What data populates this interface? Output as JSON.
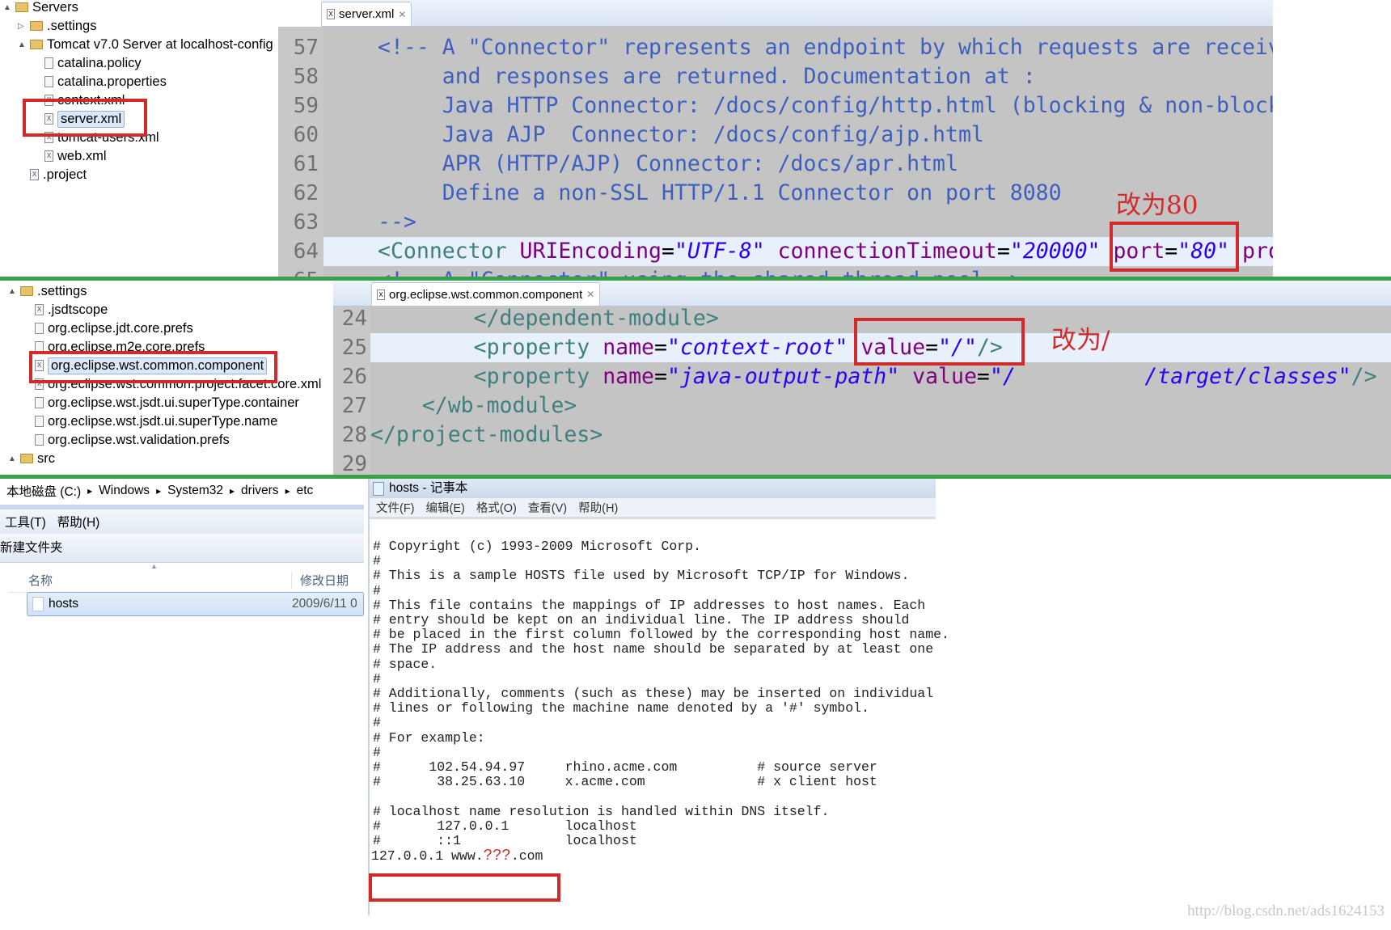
{
  "panel1": {
    "tree": [
      {
        "label": "Servers",
        "icon": "folder-open-icon",
        "depth": 0,
        "arrow": "▲"
      },
      {
        "label": ".settings",
        "icon": "folder-icon",
        "depth": 1,
        "arrow": "▷"
      },
      {
        "label": "Tomcat v7.0 Server at localhost-config",
        "icon": "folder-open-icon",
        "depth": 1,
        "arrow": "▲"
      },
      {
        "label": "catalina.policy",
        "icon": "file-icon",
        "depth": 2
      },
      {
        "label": "catalina.properties",
        "icon": "file-icon",
        "depth": 2
      },
      {
        "label": "context.xml",
        "icon": "xml-file-icon",
        "depth": 2
      },
      {
        "label": "server.xml",
        "icon": "xml-file-icon",
        "depth": 2,
        "selected": true
      },
      {
        "label": "tomcat-users.xml",
        "icon": "xml-file-icon",
        "depth": 2
      },
      {
        "label": "web.xml",
        "icon": "xml-file-icon",
        "depth": 2
      },
      {
        "label": ".project",
        "icon": "xml-file-icon",
        "depth": 1
      }
    ],
    "tab": "server.xml",
    "lines": [
      {
        "n": "57",
        "tokens": [
          [
            "<!-- A \"Connector\" represents an endpoint by which requests are received",
            "comment"
          ]
        ]
      },
      {
        "n": "58",
        "tokens": [
          [
            "     and responses are returned. Documentation at :",
            "comment"
          ]
        ]
      },
      {
        "n": "59",
        "tokens": [
          [
            "     Java HTTP Connector: /docs/config/http.html (blocking & non-blocking)",
            "comment"
          ]
        ]
      },
      {
        "n": "60",
        "tokens": [
          [
            "     Java AJP  Connector: /docs/config/ajp.html",
            "comment"
          ]
        ]
      },
      {
        "n": "61",
        "tokens": [
          [
            "     APR (HTTP/AJP) Connector: /docs/apr.html",
            "comment"
          ]
        ]
      },
      {
        "n": "62",
        "tokens": [
          [
            "     Define a non-SSL HTTP/1.1 Connector on port 8080",
            "comment"
          ]
        ]
      },
      {
        "n": "63",
        "tokens": [
          [
            "-->",
            "comment"
          ]
        ]
      },
      {
        "n": "64",
        "highlight": true,
        "tokens": [
          [
            "<Connector",
            "tag"
          ],
          [
            " URIEncoding",
            "attr"
          ],
          [
            "=",
            "punct"
          ],
          [
            "\"UTF-8\"",
            "val"
          ],
          [
            " connectionTimeout",
            "attr"
          ],
          [
            "=",
            "punct"
          ],
          [
            "\"20000\"",
            "val"
          ],
          [
            " port",
            "attr"
          ],
          [
            "=",
            "punct"
          ],
          [
            "\"80\"",
            "val"
          ],
          [
            " protocol",
            "attr"
          ]
        ]
      },
      {
        "n": "65",
        "tokens": [
          [
            "<!-- A \"Connector\" using the shared thread pool-->",
            "comment"
          ]
        ]
      }
    ],
    "annotation": "改为80"
  },
  "panel2": {
    "tree": [
      {
        "label": ".settings",
        "icon": "folder-open-icon",
        "depth": 0,
        "arrow": "▲"
      },
      {
        "label": ".jsdtscope",
        "icon": "xml-file-icon",
        "depth": 1
      },
      {
        "label": "org.eclipse.jdt.core.prefs",
        "icon": "file-icon",
        "depth": 1
      },
      {
        "label": "org.eclipse.m2e.core.prefs",
        "icon": "file-icon",
        "depth": 1
      },
      {
        "label": "org.eclipse.wst.common.component",
        "icon": "xml-file-icon",
        "depth": 1,
        "selected": true
      },
      {
        "label": "org.eclipse.wst.common.project.facet.core.xml",
        "icon": "xml-file-icon",
        "depth": 1
      },
      {
        "label": "org.eclipse.wst.jsdt.ui.superType.container",
        "icon": "file-icon",
        "depth": 1
      },
      {
        "label": "org.eclipse.wst.jsdt.ui.superType.name",
        "icon": "file-icon",
        "depth": 1
      },
      {
        "label": "org.eclipse.wst.validation.prefs",
        "icon": "file-icon",
        "depth": 1
      },
      {
        "label": "src",
        "icon": "source-folder-icon",
        "depth": 0,
        "arrow": "▲"
      }
    ],
    "tab": "org.eclipse.wst.common.component",
    "lines": [
      {
        "n": "24",
        "tokens": [
          [
            "        </dependent-module>",
            "tag"
          ]
        ]
      },
      {
        "n": "25",
        "highlight": true,
        "tokens": [
          [
            "        <property",
            "tag"
          ],
          [
            " name",
            "attr"
          ],
          [
            "=",
            "punct"
          ],
          [
            "\"context-root\"",
            "val"
          ],
          [
            " value",
            "attr"
          ],
          [
            "=",
            "punct"
          ],
          [
            "\"/\"",
            "val"
          ],
          [
            "/>",
            "tag"
          ]
        ]
      },
      {
        "n": "26",
        "tokens": [
          [
            "        <property",
            "tag"
          ],
          [
            " name",
            "attr"
          ],
          [
            "=",
            "punct"
          ],
          [
            "\"java-output-path\"",
            "val"
          ],
          [
            " value",
            "attr"
          ],
          [
            "=",
            "punct"
          ],
          [
            "\"/          /target/classes\"",
            "val"
          ],
          [
            "/>",
            "tag"
          ]
        ]
      },
      {
        "n": "27",
        "tokens": [
          [
            "    </wb-module>",
            "tag"
          ]
        ]
      },
      {
        "n": "28",
        "tokens": [
          [
            "</project-modules>",
            "tag"
          ]
        ]
      },
      {
        "n": "29",
        "tokens": []
      }
    ],
    "annotation": "改为/"
  },
  "explorer": {
    "breadcrumb": [
      "本地磁盘 (C:)",
      "Windows",
      "System32",
      "drivers",
      "etc"
    ],
    "menu": [
      "工具(T)",
      "帮助(H)"
    ],
    "toolbar_new_folder": "新建文件夹",
    "columns": {
      "name": "名称",
      "modified": "修改日期"
    },
    "files": [
      {
        "name": "hosts",
        "modified": "2009/6/11 0"
      }
    ]
  },
  "notepad": {
    "title": "hosts - 记事本",
    "menu": [
      "文件(F)",
      "编辑(E)",
      "格式(O)",
      "查看(V)",
      "帮助(H)"
    ],
    "lines": [
      "# Copyright (c) 1993-2009 Microsoft Corp.",
      "#",
      "# This is a sample HOSTS file used by Microsoft TCP/IP for Windows.",
      "#",
      "# This file contains the mappings of IP addresses to host names. Each",
      "# entry should be kept on an individual line. The IP address should",
      "# be placed in the first column followed by the corresponding host name.",
      "# The IP address and the host name should be separated by at least one",
      "# space.",
      "#",
      "# Additionally, comments (such as these) may be inserted on individual",
      "# lines or following the machine name denoted by a '#' symbol.",
      "#",
      "# For example:",
      "#",
      "#      102.54.94.97     rhino.acme.com          # source server",
      "#       38.25.63.10     x.acme.com              # x client host",
      "",
      "# localhost name resolution is handled within DNS itself.",
      "#       127.0.0.1       localhost",
      "#       ::1             localhost"
    ],
    "added_line": {
      "prefix": "127.0.0.1 www.",
      "placeholder": "???",
      "suffix": ".com"
    }
  },
  "watermark": "http://blog.csdn.net/ads1624153",
  "colors": {
    "annotation_red": "#d02a2a",
    "divider_green": "#3aa04c"
  }
}
